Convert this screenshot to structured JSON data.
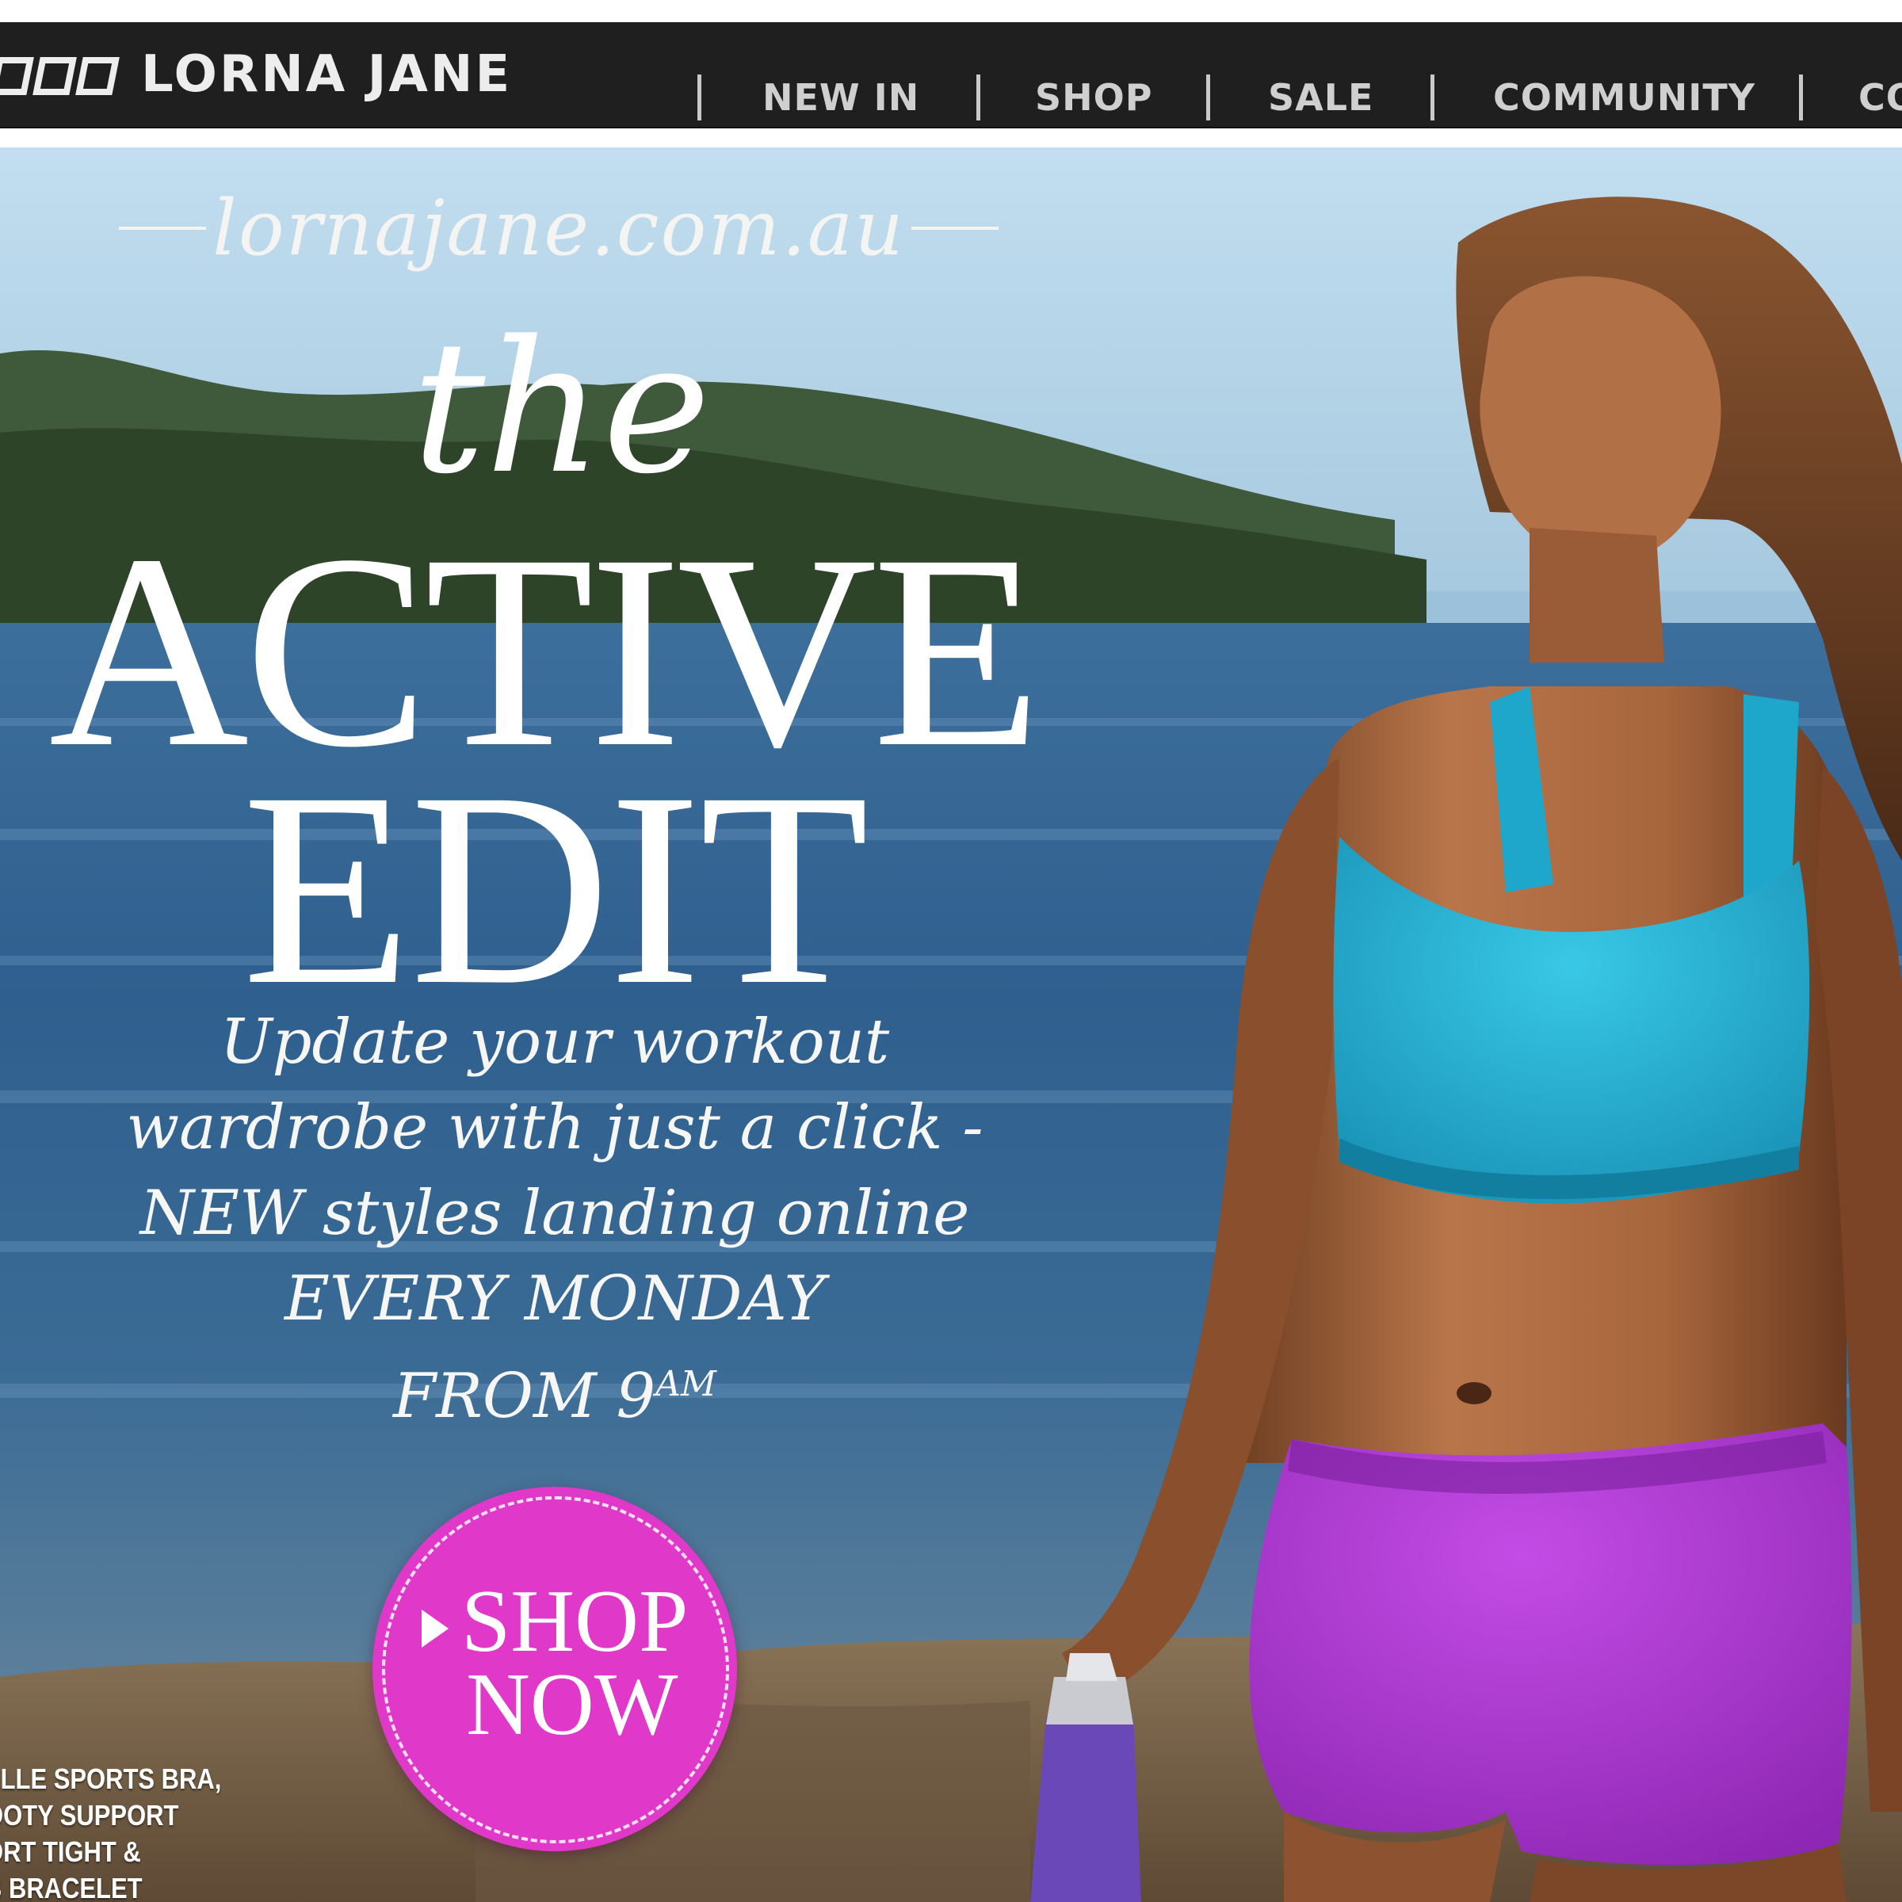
{
  "brand": {
    "name": "LORNA JANE"
  },
  "nav": {
    "items": [
      {
        "label": "NEW IN"
      },
      {
        "label": "SHOP"
      },
      {
        "label": "SALE"
      },
      {
        "label": "COMMUNITY"
      },
      {
        "label": "CO"
      }
    ]
  },
  "hero": {
    "site_url": "lornajane.com.au",
    "headline_the": "the",
    "headline_active": "ACTIVE",
    "headline_edit": "EDIT",
    "tagline": {
      "line1": "Update your workout",
      "line2": "wardrobe with just a click -",
      "line3": "NEW styles landing online",
      "line4": "EVERY MONDAY",
      "line5_prefix": "FROM 9",
      "line5_sup": "AM"
    },
    "cta": {
      "line1": "SHOP",
      "line2": "NOW",
      "icon": "play-arrow-icon"
    },
    "caption": {
      "line1": "ELLE SPORTS BRA,",
      "line2": "OOTY SUPPORT",
      "line3": "ORT TIGHT &",
      "line4": "B BRACELET"
    }
  },
  "colors": {
    "nav_background": "#1f1f1f",
    "nav_text": "#cfcfcf",
    "cta_pink": "#e038c9",
    "sports_bra_teal": "#2bb6d6",
    "shorts_purple": "#b23ad8"
  }
}
